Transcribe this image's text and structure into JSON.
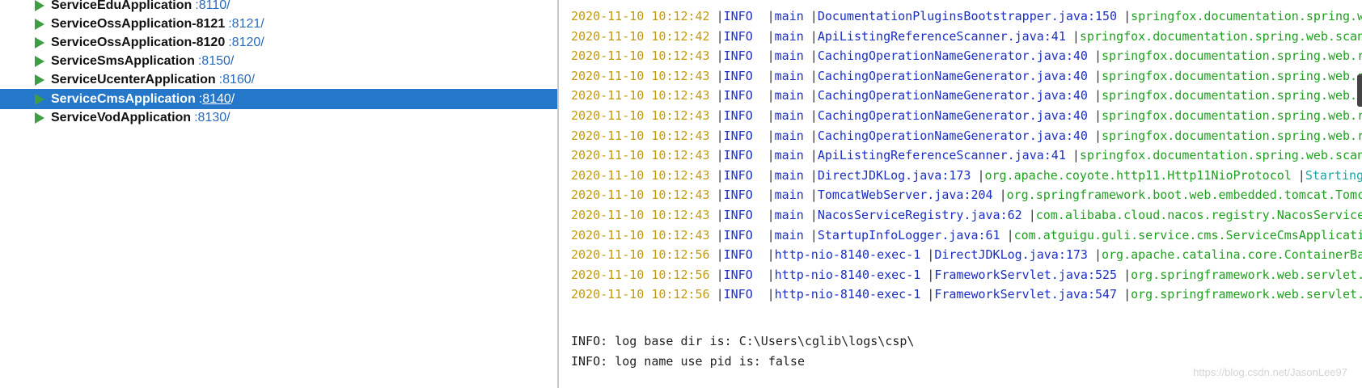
{
  "services": [
    {
      "name": "ServiceEduApplication",
      "port": "8110",
      "selected": false
    },
    {
      "name": "ServiceOssApplication-8121",
      "port": "8121",
      "selected": false
    },
    {
      "name": "ServiceOssApplication-8120",
      "port": "8120",
      "selected": false
    },
    {
      "name": "ServiceSmsApplication",
      "port": "8150",
      "selected": false
    },
    {
      "name": "ServiceUcenterApplication",
      "port": "8160",
      "selected": false
    },
    {
      "name": "ServiceCmsApplication",
      "port": "8140",
      "selected": true
    },
    {
      "name": "ServiceVodApplication",
      "port": "8130",
      "selected": false
    }
  ],
  "port_prefix": ":",
  "port_suffix": "/",
  "log_separator": "|",
  "log_lines": [
    {
      "ts": "2020-11-10 10:12:42",
      "level": "INFO",
      "thread": "main",
      "location": "DocumentationPluginsBootstrapper.java:150",
      "logger": "springfox.documentation.spring.w",
      "msg": ""
    },
    {
      "ts": "2020-11-10 10:12:42",
      "level": "INFO",
      "thread": "main",
      "location": "ApiListingReferenceScanner.java:41",
      "logger": "springfox.documentation.spring.web.scan",
      "msg": ""
    },
    {
      "ts": "2020-11-10 10:12:43",
      "level": "INFO",
      "thread": "main",
      "location": "CachingOperationNameGenerator.java:40",
      "logger": "springfox.documentation.spring.web.r",
      "msg": ""
    },
    {
      "ts": "2020-11-10 10:12:43",
      "level": "INFO",
      "thread": "main",
      "location": "CachingOperationNameGenerator.java:40",
      "logger": "springfox.documentation.spring.web.r",
      "msg": ""
    },
    {
      "ts": "2020-11-10 10:12:43",
      "level": "INFO",
      "thread": "main",
      "location": "CachingOperationNameGenerator.java:40",
      "logger": "springfox.documentation.spring.web.",
      "msg": ""
    },
    {
      "ts": "2020-11-10 10:12:43",
      "level": "INFO",
      "thread": "main",
      "location": "CachingOperationNameGenerator.java:40",
      "logger": "springfox.documentation.spring.web.r",
      "msg": ""
    },
    {
      "ts": "2020-11-10 10:12:43",
      "level": "INFO",
      "thread": "main",
      "location": "CachingOperationNameGenerator.java:40",
      "logger": "springfox.documentation.spring.web.r",
      "msg": ""
    },
    {
      "ts": "2020-11-10 10:12:43",
      "level": "INFO",
      "thread": "main",
      "location": "ApiListingReferenceScanner.java:41",
      "logger": "springfox.documentation.spring.web.scan",
      "msg": ""
    },
    {
      "ts": "2020-11-10 10:12:43",
      "level": "INFO",
      "thread": "main",
      "location": "DirectJDKLog.java:173",
      "logger": "org.apache.coyote.http11.Http11NioProtocol",
      "msg": "Starting"
    },
    {
      "ts": "2020-11-10 10:12:43",
      "level": "INFO",
      "thread": "main",
      "location": "TomcatWebServer.java:204",
      "logger": "org.springframework.boot.web.embedded.tomcat.Tomc",
      "msg": ""
    },
    {
      "ts": "2020-11-10 10:12:43",
      "level": "INFO",
      "thread": "main",
      "location": "NacosServiceRegistry.java:62",
      "logger": "com.alibaba.cloud.nacos.registry.NacosService",
      "msg": ""
    },
    {
      "ts": "2020-11-10 10:12:43",
      "level": "INFO",
      "thread": "main",
      "location": "StartupInfoLogger.java:61",
      "logger": "com.atguigu.guli.service.cms.ServiceCmsApplicatio",
      "msg": ""
    },
    {
      "ts": "2020-11-10 10:12:56",
      "level": "INFO",
      "thread": "http-nio-8140-exec-1",
      "location": "DirectJDKLog.java:173",
      "logger": "org.apache.catalina.core.ContainerBa",
      "msg": ""
    },
    {
      "ts": "2020-11-10 10:12:56",
      "level": "INFO",
      "thread": "http-nio-8140-exec-1",
      "location": "FrameworkServlet.java:525",
      "logger": "org.springframework.web.servlet.",
      "msg": ""
    },
    {
      "ts": "2020-11-10 10:12:56",
      "level": "INFO",
      "thread": "http-nio-8140-exec-1",
      "location": "FrameworkServlet.java:547",
      "logger": "org.springframework.web.servlet.",
      "msg": ""
    }
  ],
  "plain_lines": [
    "INFO: log base dir is: C:\\Users\\cglib\\logs\\csp\\",
    "INFO: log name use pid is: false"
  ],
  "watermark": "https://blog.csdn.net/JasonLee97",
  "colors": {
    "selection": "#2477c9",
    "run_triangle": "#3f9e43",
    "timestamp": "#c29b0c",
    "level": "#1b2fc2",
    "logger": "#20a020",
    "message": "#1aa5a5"
  }
}
